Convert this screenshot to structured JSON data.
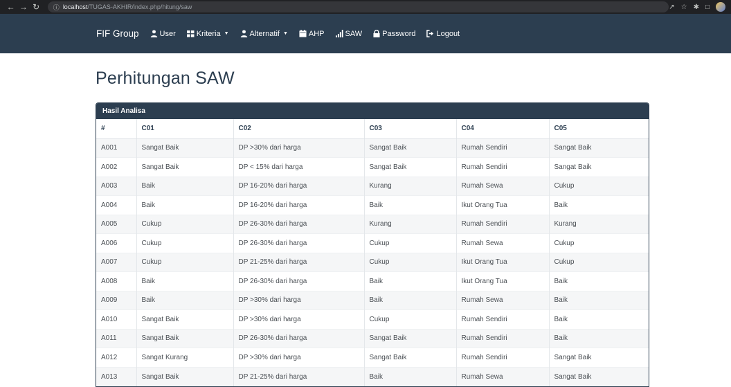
{
  "browser": {
    "url_host": "localhost",
    "url_path": "/TUGAS-AKHIR/index.php/hitung/saw"
  },
  "navbar": {
    "brand": "FIF Group",
    "items": [
      {
        "label": "User",
        "icon": "user-icon",
        "dropdown": false
      },
      {
        "label": "Kriteria",
        "icon": "grid-icon",
        "dropdown": true
      },
      {
        "label": "Alternatif",
        "icon": "user-icon",
        "dropdown": true
      },
      {
        "label": "AHP",
        "icon": "calendar-icon",
        "dropdown": false
      },
      {
        "label": "SAW",
        "icon": "signal-icon",
        "dropdown": false
      },
      {
        "label": "Password",
        "icon": "lock-icon",
        "dropdown": false
      },
      {
        "label": "Logout",
        "icon": "logout-icon",
        "dropdown": false
      }
    ]
  },
  "page": {
    "title": "Perhitungan SAW"
  },
  "panel": {
    "heading": "Hasil Analisa",
    "columns": [
      "#",
      "C01",
      "C02",
      "C03",
      "C04",
      "C05"
    ],
    "rows": [
      [
        "A001",
        "Sangat Baik",
        "DP >30% dari harga",
        "Sangat Baik",
        "Rumah Sendiri",
        "Sangat Baik"
      ],
      [
        "A002",
        "Sangat Baik",
        "DP < 15% dari harga",
        "Sangat Baik",
        "Rumah Sendiri",
        "Sangat Baik"
      ],
      [
        "A003",
        "Baik",
        "DP 16-20% dari harga",
        "Kurang",
        "Rumah Sewa",
        "Cukup"
      ],
      [
        "A004",
        "Baik",
        "DP 16-20% dari harga",
        "Baik",
        "Ikut Orang Tua",
        "Baik"
      ],
      [
        "A005",
        "Cukup",
        "DP 26-30% dari harga",
        "Kurang",
        "Rumah Sendiri",
        "Kurang"
      ],
      [
        "A006",
        "Cukup",
        "DP 26-30% dari harga",
        "Cukup",
        "Rumah Sewa",
        "Cukup"
      ],
      [
        "A007",
        "Cukup",
        "DP 21-25% dari harga",
        "Cukup",
        "Ikut Orang Tua",
        "Cukup"
      ],
      [
        "A008",
        "Baik",
        "DP 26-30% dari harga",
        "Baik",
        "Ikut Orang Tua",
        "Baik"
      ],
      [
        "A009",
        "Baik",
        "DP >30% dari harga",
        "Baik",
        "Rumah Sewa",
        "Baik"
      ],
      [
        "A010",
        "Sangat Baik",
        "DP >30% dari harga",
        "Cukup",
        "Rumah Sendiri",
        "Baik"
      ],
      [
        "A011",
        "Sangat Baik",
        "DP 26-30% dari harga",
        "Sangat Baik",
        "Rumah Sendiri",
        "Baik"
      ],
      [
        "A012",
        "Sangat Kurang",
        "DP >30% dari harga",
        "Sangat Baik",
        "Rumah Sendiri",
        "Sangat Baik"
      ],
      [
        "A013",
        "Sangat Baik",
        "DP 21-25% dari harga",
        "Baik",
        "Rumah Sewa",
        "Sangat Baik"
      ]
    ]
  },
  "colors": {
    "navbar_bg": "#2c3e50",
    "accent_text": "#2c3e50"
  }
}
